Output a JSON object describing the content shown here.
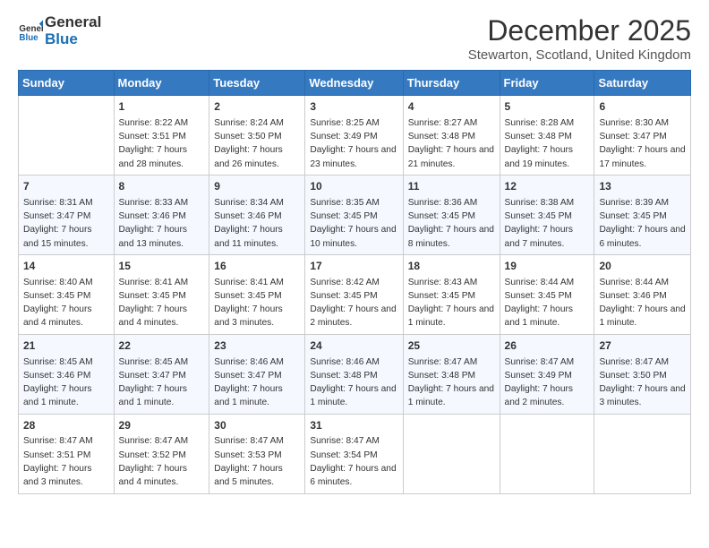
{
  "logo": {
    "line1": "General",
    "line2": "Blue"
  },
  "title": "December 2025",
  "location": "Stewarton, Scotland, United Kingdom",
  "days_of_week": [
    "Sunday",
    "Monday",
    "Tuesday",
    "Wednesday",
    "Thursday",
    "Friday",
    "Saturday"
  ],
  "weeks": [
    [
      {
        "day": "",
        "sunrise": "",
        "sunset": "",
        "daylight": ""
      },
      {
        "day": "1",
        "sunrise": "Sunrise: 8:22 AM",
        "sunset": "Sunset: 3:51 PM",
        "daylight": "Daylight: 7 hours and 28 minutes."
      },
      {
        "day": "2",
        "sunrise": "Sunrise: 8:24 AM",
        "sunset": "Sunset: 3:50 PM",
        "daylight": "Daylight: 7 hours and 26 minutes."
      },
      {
        "day": "3",
        "sunrise": "Sunrise: 8:25 AM",
        "sunset": "Sunset: 3:49 PM",
        "daylight": "Daylight: 7 hours and 23 minutes."
      },
      {
        "day": "4",
        "sunrise": "Sunrise: 8:27 AM",
        "sunset": "Sunset: 3:48 PM",
        "daylight": "Daylight: 7 hours and 21 minutes."
      },
      {
        "day": "5",
        "sunrise": "Sunrise: 8:28 AM",
        "sunset": "Sunset: 3:48 PM",
        "daylight": "Daylight: 7 hours and 19 minutes."
      },
      {
        "day": "6",
        "sunrise": "Sunrise: 8:30 AM",
        "sunset": "Sunset: 3:47 PM",
        "daylight": "Daylight: 7 hours and 17 minutes."
      }
    ],
    [
      {
        "day": "7",
        "sunrise": "Sunrise: 8:31 AM",
        "sunset": "Sunset: 3:47 PM",
        "daylight": "Daylight: 7 hours and 15 minutes."
      },
      {
        "day": "8",
        "sunrise": "Sunrise: 8:33 AM",
        "sunset": "Sunset: 3:46 PM",
        "daylight": "Daylight: 7 hours and 13 minutes."
      },
      {
        "day": "9",
        "sunrise": "Sunrise: 8:34 AM",
        "sunset": "Sunset: 3:46 PM",
        "daylight": "Daylight: 7 hours and 11 minutes."
      },
      {
        "day": "10",
        "sunrise": "Sunrise: 8:35 AM",
        "sunset": "Sunset: 3:45 PM",
        "daylight": "Daylight: 7 hours and 10 minutes."
      },
      {
        "day": "11",
        "sunrise": "Sunrise: 8:36 AM",
        "sunset": "Sunset: 3:45 PM",
        "daylight": "Daylight: 7 hours and 8 minutes."
      },
      {
        "day": "12",
        "sunrise": "Sunrise: 8:38 AM",
        "sunset": "Sunset: 3:45 PM",
        "daylight": "Daylight: 7 hours and 7 minutes."
      },
      {
        "day": "13",
        "sunrise": "Sunrise: 8:39 AM",
        "sunset": "Sunset: 3:45 PM",
        "daylight": "Daylight: 7 hours and 6 minutes."
      }
    ],
    [
      {
        "day": "14",
        "sunrise": "Sunrise: 8:40 AM",
        "sunset": "Sunset: 3:45 PM",
        "daylight": "Daylight: 7 hours and 4 minutes."
      },
      {
        "day": "15",
        "sunrise": "Sunrise: 8:41 AM",
        "sunset": "Sunset: 3:45 PM",
        "daylight": "Daylight: 7 hours and 4 minutes."
      },
      {
        "day": "16",
        "sunrise": "Sunrise: 8:41 AM",
        "sunset": "Sunset: 3:45 PM",
        "daylight": "Daylight: 7 hours and 3 minutes."
      },
      {
        "day": "17",
        "sunrise": "Sunrise: 8:42 AM",
        "sunset": "Sunset: 3:45 PM",
        "daylight": "Daylight: 7 hours and 2 minutes."
      },
      {
        "day": "18",
        "sunrise": "Sunrise: 8:43 AM",
        "sunset": "Sunset: 3:45 PM",
        "daylight": "Daylight: 7 hours and 1 minute."
      },
      {
        "day": "19",
        "sunrise": "Sunrise: 8:44 AM",
        "sunset": "Sunset: 3:45 PM",
        "daylight": "Daylight: 7 hours and 1 minute."
      },
      {
        "day": "20",
        "sunrise": "Sunrise: 8:44 AM",
        "sunset": "Sunset: 3:46 PM",
        "daylight": "Daylight: 7 hours and 1 minute."
      }
    ],
    [
      {
        "day": "21",
        "sunrise": "Sunrise: 8:45 AM",
        "sunset": "Sunset: 3:46 PM",
        "daylight": "Daylight: 7 hours and 1 minute."
      },
      {
        "day": "22",
        "sunrise": "Sunrise: 8:45 AM",
        "sunset": "Sunset: 3:47 PM",
        "daylight": "Daylight: 7 hours and 1 minute."
      },
      {
        "day": "23",
        "sunrise": "Sunrise: 8:46 AM",
        "sunset": "Sunset: 3:47 PM",
        "daylight": "Daylight: 7 hours and 1 minute."
      },
      {
        "day": "24",
        "sunrise": "Sunrise: 8:46 AM",
        "sunset": "Sunset: 3:48 PM",
        "daylight": "Daylight: 7 hours and 1 minute."
      },
      {
        "day": "25",
        "sunrise": "Sunrise: 8:47 AM",
        "sunset": "Sunset: 3:48 PM",
        "daylight": "Daylight: 7 hours and 1 minute."
      },
      {
        "day": "26",
        "sunrise": "Sunrise: 8:47 AM",
        "sunset": "Sunset: 3:49 PM",
        "daylight": "Daylight: 7 hours and 2 minutes."
      },
      {
        "day": "27",
        "sunrise": "Sunrise: 8:47 AM",
        "sunset": "Sunset: 3:50 PM",
        "daylight": "Daylight: 7 hours and 3 minutes."
      }
    ],
    [
      {
        "day": "28",
        "sunrise": "Sunrise: 8:47 AM",
        "sunset": "Sunset: 3:51 PM",
        "daylight": "Daylight: 7 hours and 3 minutes."
      },
      {
        "day": "29",
        "sunrise": "Sunrise: 8:47 AM",
        "sunset": "Sunset: 3:52 PM",
        "daylight": "Daylight: 7 hours and 4 minutes."
      },
      {
        "day": "30",
        "sunrise": "Sunrise: 8:47 AM",
        "sunset": "Sunset: 3:53 PM",
        "daylight": "Daylight: 7 hours and 5 minutes."
      },
      {
        "day": "31",
        "sunrise": "Sunrise: 8:47 AM",
        "sunset": "Sunset: 3:54 PM",
        "daylight": "Daylight: 7 hours and 6 minutes."
      },
      {
        "day": "",
        "sunrise": "",
        "sunset": "",
        "daylight": ""
      },
      {
        "day": "",
        "sunrise": "",
        "sunset": "",
        "daylight": ""
      },
      {
        "day": "",
        "sunrise": "",
        "sunset": "",
        "daylight": ""
      }
    ]
  ]
}
